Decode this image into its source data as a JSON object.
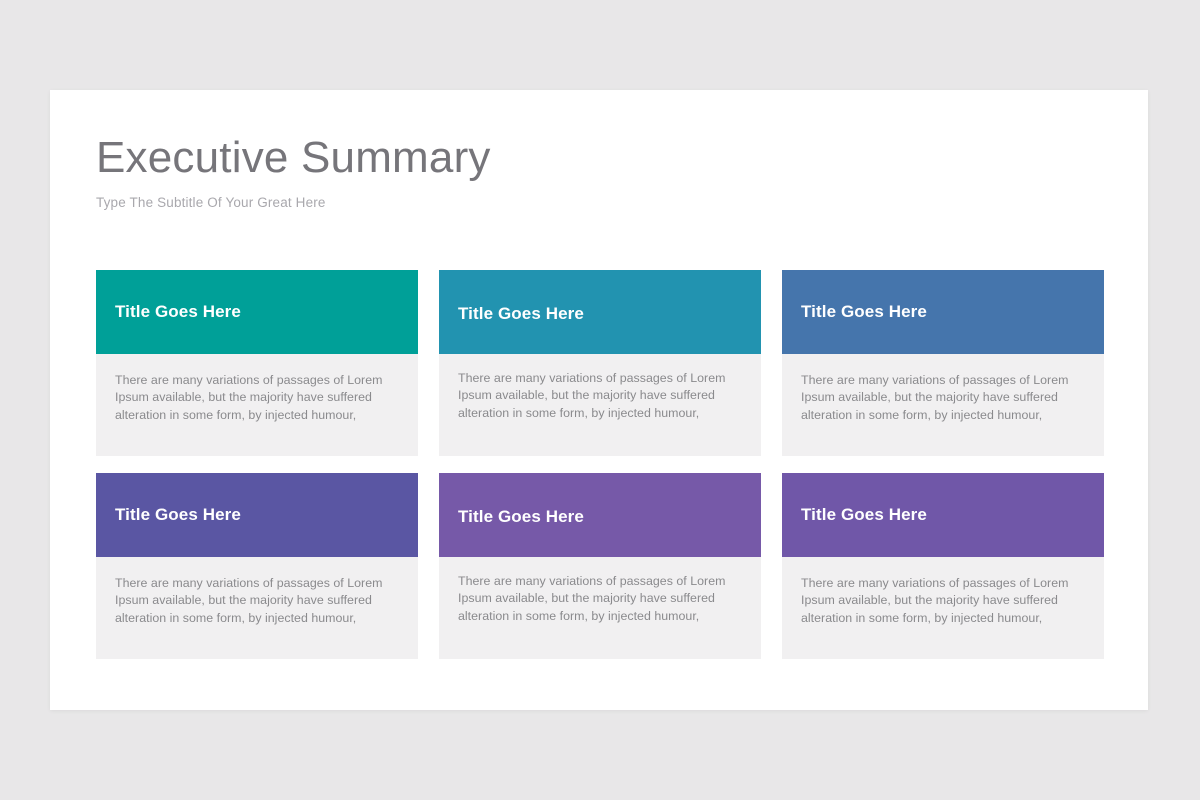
{
  "theme": {
    "page_background": "#E8E7E8",
    "slide_background": "#FFFFFF",
    "title_color": "#76757A",
    "subtitle_color": "#A9A8AD",
    "card_body_background": "#F1F0F1",
    "card_body_text_color": "#8A8A8D",
    "card_title_color": "#FFFFFF"
  },
  "slide": {
    "title": "Executive Summary",
    "subtitle": "Type The Subtitle Of Your Great Here"
  },
  "cards": [
    {
      "title": "Title Goes Here",
      "body": "There are many variations of passages of Lorem Ipsum available, but the majority have suffered alteration in some form, by injected humour,",
      "header_color": "#00A098",
      "position": "row-1-col-1"
    },
    {
      "title": "Title Goes Here",
      "body": "There are many variations of passages of Lorem Ipsum available, but the majority have suffered alteration in some form, by injected humour,",
      "header_color": "#2293B0",
      "position": "row-1-col-2"
    },
    {
      "title": "Title Goes Here",
      "body": "There are many variations of passages of Lorem Ipsum available, but the majority have suffered alteration in some form, by injected humour,",
      "header_color": "#4575AC",
      "position": "row-1-col-3"
    },
    {
      "title": "Title Goes Here",
      "body": "There are many variations of passages of Lorem Ipsum available, but the majority have suffered alteration in some form, by injected humour,",
      "header_color": "#5A56A3",
      "position": "row-2-col-1"
    },
    {
      "title": "Title Goes Here",
      "body": "There are many variations of passages of Lorem Ipsum available, but the majority have suffered alteration in some form, by injected humour,",
      "header_color": "#7659A8",
      "position": "row-2-col-2"
    },
    {
      "title": "Title Goes Here",
      "body": "There are many variations of passages of Lorem Ipsum available, but the majority have suffered alteration in some form, by injected humour,",
      "header_color": "#7057A8",
      "position": "row-2-col-3"
    }
  ]
}
